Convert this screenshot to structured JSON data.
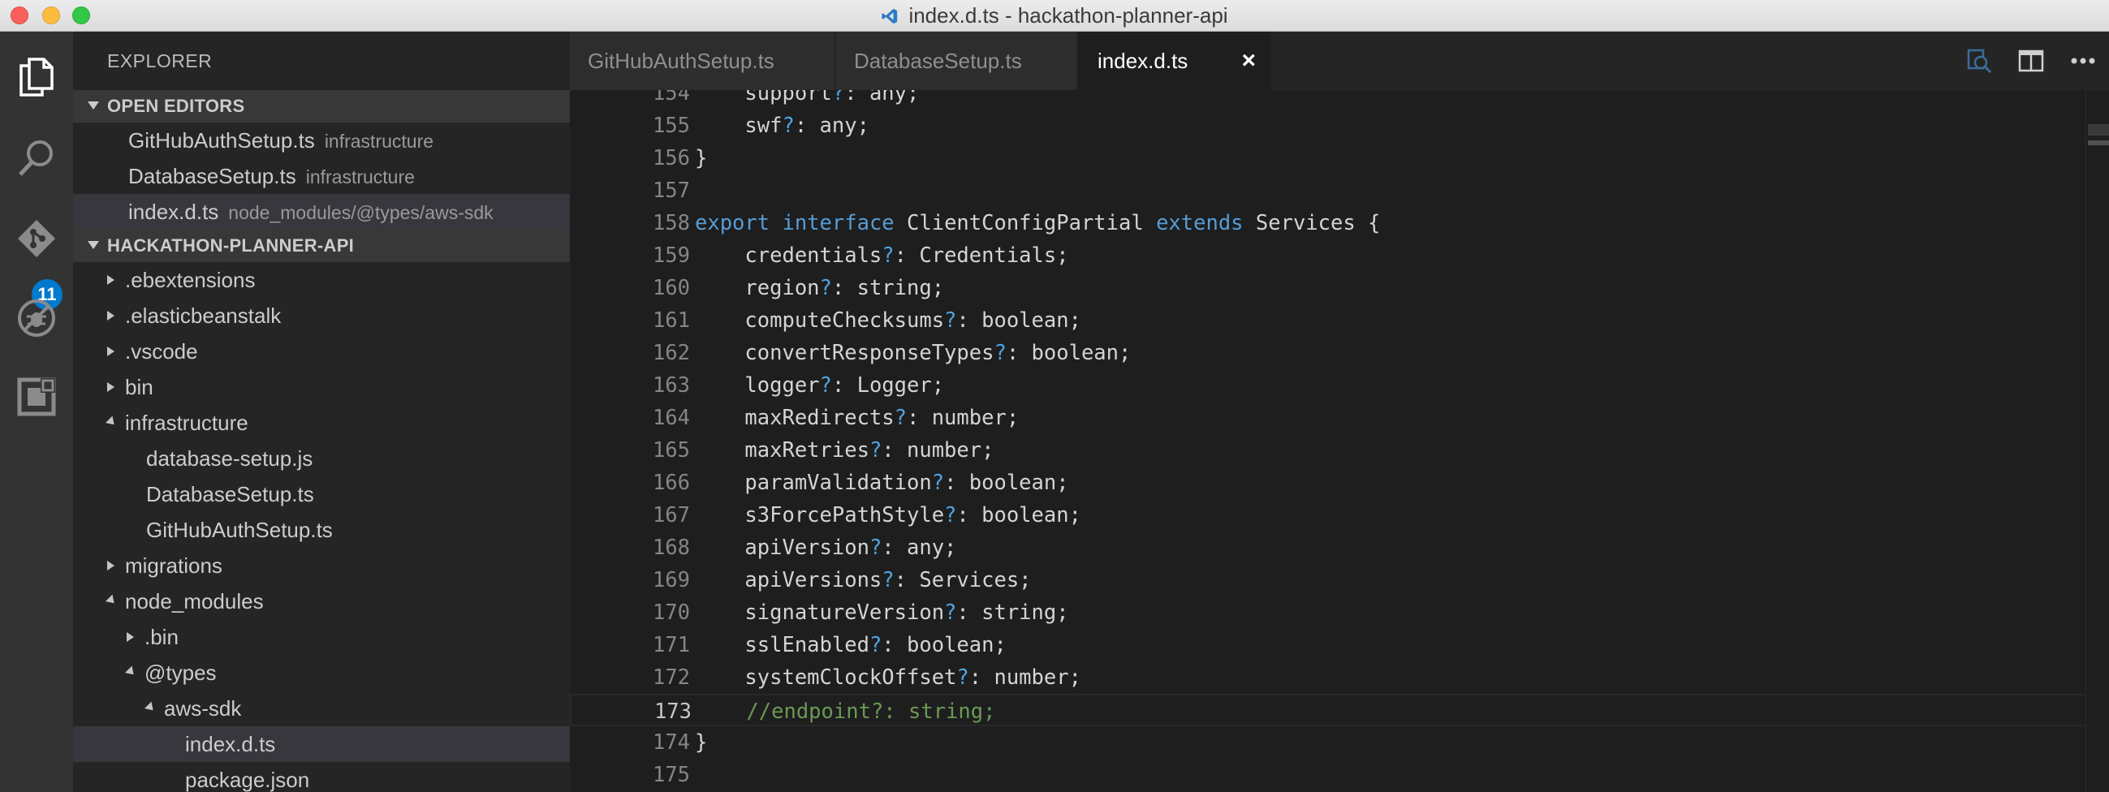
{
  "window": {
    "title": "index.d.ts - hackathon-planner-api"
  },
  "activity_bar": {
    "items": [
      {
        "name": "explorer",
        "icon": "files-icon"
      },
      {
        "name": "search",
        "icon": "search-icon"
      },
      {
        "name": "source-control",
        "icon": "git-icon",
        "badge": "11"
      },
      {
        "name": "debug",
        "icon": "debug-icon"
      },
      {
        "name": "extensions",
        "icon": "extensions-icon"
      }
    ]
  },
  "sidebar": {
    "title": "EXPLORER",
    "open_editors": {
      "label": "OPEN EDITORS",
      "items": [
        {
          "name": "GitHubAuthSetup.ts",
          "desc": "infrastructure"
        },
        {
          "name": "DatabaseSetup.ts",
          "desc": "infrastructure"
        },
        {
          "name": "index.d.ts",
          "desc": "node_modules/@types/aws-sdk"
        }
      ]
    },
    "project": {
      "label": "HACKATHON-PLANNER-API",
      "tree": [
        {
          "label": ".ebextensions",
          "depth": 0,
          "kind": "folder-closed"
        },
        {
          "label": ".elasticbeanstalk",
          "depth": 0,
          "kind": "folder-closed"
        },
        {
          "label": ".vscode",
          "depth": 0,
          "kind": "folder-closed"
        },
        {
          "label": "bin",
          "depth": 0,
          "kind": "folder-closed"
        },
        {
          "label": "infrastructure",
          "depth": 0,
          "kind": "folder-open"
        },
        {
          "label": "database-setup.js",
          "depth": 1,
          "kind": "file"
        },
        {
          "label": "DatabaseSetup.ts",
          "depth": 1,
          "kind": "file"
        },
        {
          "label": "GitHubAuthSetup.ts",
          "depth": 1,
          "kind": "file"
        },
        {
          "label": "migrations",
          "depth": 0,
          "kind": "folder-closed"
        },
        {
          "label": "node_modules",
          "depth": 0,
          "kind": "folder-open"
        },
        {
          "label": ".bin",
          "depth": 1,
          "kind": "folder-closed"
        },
        {
          "label": "@types",
          "depth": 1,
          "kind": "folder-open"
        },
        {
          "label": "aws-sdk",
          "depth": 2,
          "kind": "folder-open"
        },
        {
          "label": "index.d.ts",
          "depth": 3,
          "kind": "file",
          "selected": true
        },
        {
          "label": "package.json",
          "depth": 3,
          "kind": "file"
        }
      ]
    }
  },
  "tabs": [
    {
      "label": "GitHubAuthSetup.ts",
      "active": false
    },
    {
      "label": "DatabaseSetup.ts",
      "active": false
    },
    {
      "label": "index.d.ts",
      "active": true,
      "close": "×"
    }
  ],
  "editor_actions": [
    {
      "name": "open-changes-icon"
    },
    {
      "name": "split-editor-icon"
    },
    {
      "name": "more-actions-icon"
    }
  ],
  "editor": {
    "current_line": 173,
    "lines": [
      {
        "num": 154,
        "tokens": [
          {
            "t": "    support"
          },
          {
            "t": "?",
            "c": "op"
          },
          {
            "t": ": any;"
          }
        ]
      },
      {
        "num": 155,
        "tokens": [
          {
            "t": "    swf"
          },
          {
            "t": "?",
            "c": "op"
          },
          {
            "t": ": any;"
          }
        ]
      },
      {
        "num": 156,
        "tokens": [
          {
            "t": "}"
          }
        ]
      },
      {
        "num": 157,
        "tokens": []
      },
      {
        "num": 158,
        "tokens": [
          {
            "t": "export",
            "c": "kw"
          },
          {
            "t": " "
          },
          {
            "t": "interface",
            "c": "kw"
          },
          {
            "t": " ClientConfigPartial "
          },
          {
            "t": "extends",
            "c": "kw"
          },
          {
            "t": " Services {"
          }
        ]
      },
      {
        "num": 159,
        "tokens": [
          {
            "t": "    credentials"
          },
          {
            "t": "?",
            "c": "op"
          },
          {
            "t": ": Credentials;"
          }
        ]
      },
      {
        "num": 160,
        "tokens": [
          {
            "t": "    region"
          },
          {
            "t": "?",
            "c": "op"
          },
          {
            "t": ": string;"
          }
        ]
      },
      {
        "num": 161,
        "tokens": [
          {
            "t": "    computeChecksums"
          },
          {
            "t": "?",
            "c": "op"
          },
          {
            "t": ": boolean;"
          }
        ]
      },
      {
        "num": 162,
        "tokens": [
          {
            "t": "    convertResponseTypes"
          },
          {
            "t": "?",
            "c": "op"
          },
          {
            "t": ": boolean;"
          }
        ]
      },
      {
        "num": 163,
        "tokens": [
          {
            "t": "    logger"
          },
          {
            "t": "?",
            "c": "op"
          },
          {
            "t": ": Logger;"
          }
        ]
      },
      {
        "num": 164,
        "tokens": [
          {
            "t": "    maxRedirects"
          },
          {
            "t": "?",
            "c": "op"
          },
          {
            "t": ": number;"
          }
        ]
      },
      {
        "num": 165,
        "tokens": [
          {
            "t": "    maxRetries"
          },
          {
            "t": "?",
            "c": "op"
          },
          {
            "t": ": number;"
          }
        ]
      },
      {
        "num": 166,
        "tokens": [
          {
            "t": "    paramValidation"
          },
          {
            "t": "?",
            "c": "op"
          },
          {
            "t": ": boolean;"
          }
        ]
      },
      {
        "num": 167,
        "tokens": [
          {
            "t": "    s3ForcePathStyle"
          },
          {
            "t": "?",
            "c": "op"
          },
          {
            "t": ": boolean;"
          }
        ]
      },
      {
        "num": 168,
        "tokens": [
          {
            "t": "    apiVersion"
          },
          {
            "t": "?",
            "c": "op"
          },
          {
            "t": ": any;"
          }
        ]
      },
      {
        "num": 169,
        "tokens": [
          {
            "t": "    apiVersions"
          },
          {
            "t": "?",
            "c": "op"
          },
          {
            "t": ": Services;"
          }
        ]
      },
      {
        "num": 170,
        "tokens": [
          {
            "t": "    signatureVersion"
          },
          {
            "t": "?",
            "c": "op"
          },
          {
            "t": ": string;"
          }
        ]
      },
      {
        "num": 171,
        "tokens": [
          {
            "t": "    sslEnabled"
          },
          {
            "t": "?",
            "c": "op"
          },
          {
            "t": ": boolean;"
          }
        ]
      },
      {
        "num": 172,
        "tokens": [
          {
            "t": "    systemClockOffset"
          },
          {
            "t": "?",
            "c": "op"
          },
          {
            "t": ": number;"
          }
        ]
      },
      {
        "num": 173,
        "tokens": [
          {
            "t": "    "
          },
          {
            "t": "//endpoint?: string;",
            "c": "cm"
          }
        ]
      },
      {
        "num": 174,
        "tokens": [
          {
            "t": "}"
          }
        ]
      },
      {
        "num": 175,
        "tokens": []
      }
    ]
  },
  "colors": {
    "keyword": "#569cd6",
    "comment": "#6a9955",
    "badge": "#007acc",
    "sidebar_bg": "#252526",
    "editor_bg": "#1e1e1e"
  }
}
